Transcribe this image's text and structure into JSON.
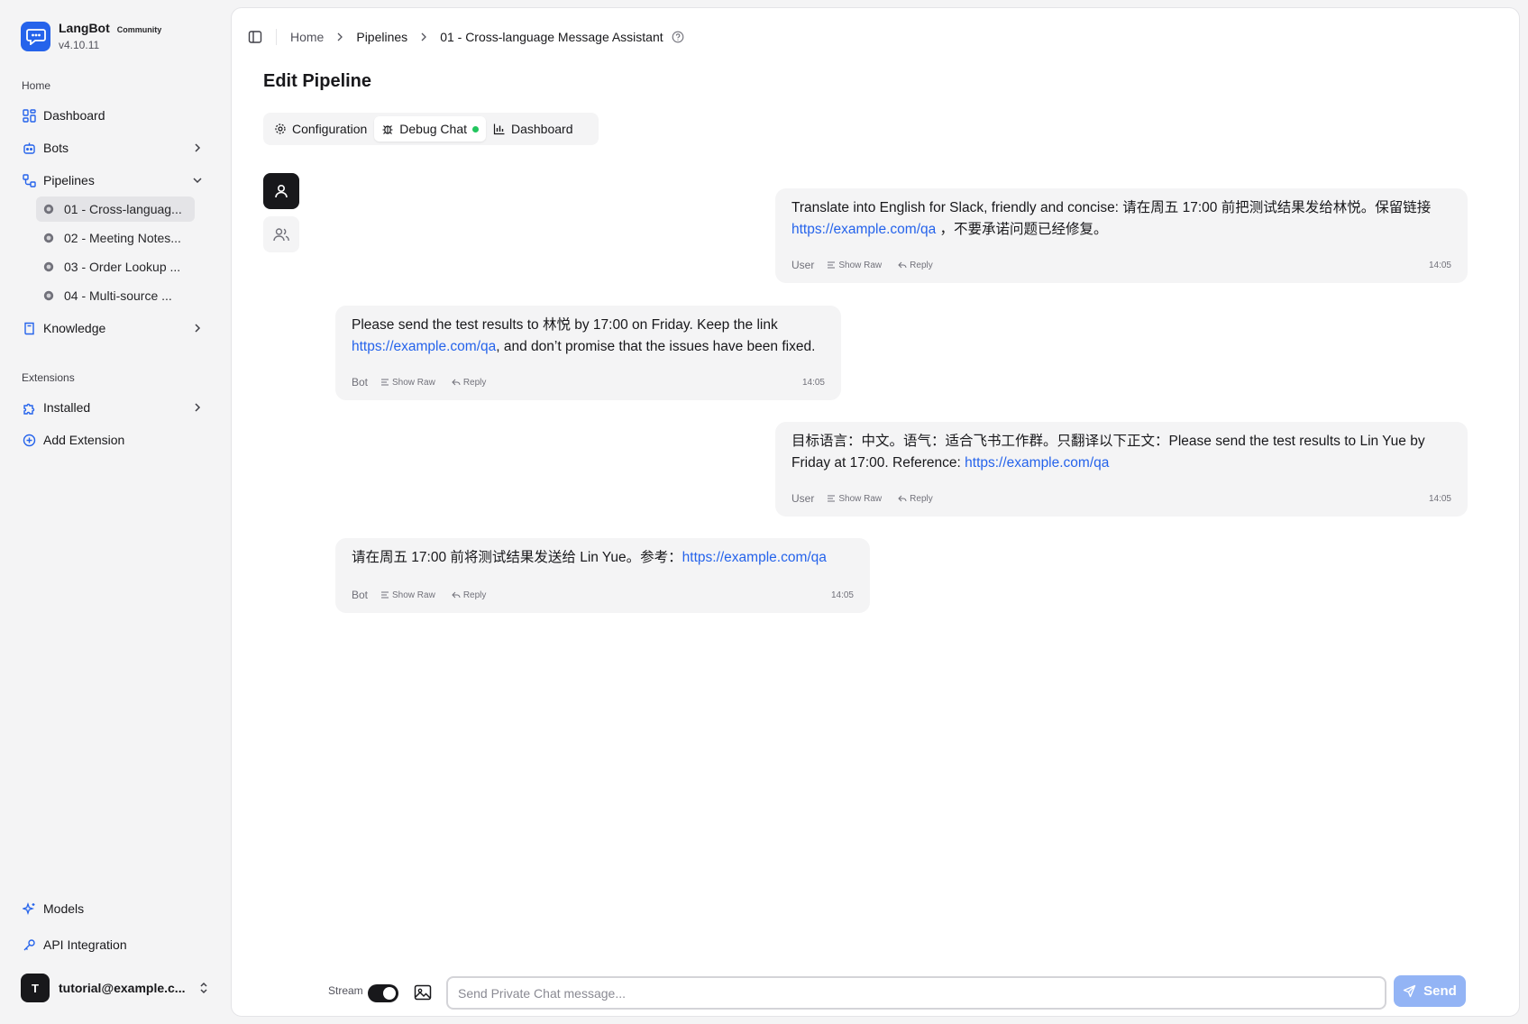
{
  "app": {
    "name": "LangBot",
    "badge": "Community",
    "version": "v4.10.11"
  },
  "sidebar": {
    "home_label": "Home",
    "extensions_label": "Extensions",
    "nav": {
      "dashboard": "Dashboard",
      "bots": "Bots",
      "pipelines": "Pipelines",
      "knowledge": "Knowledge",
      "installed": "Installed",
      "add_extension": "Add Extension",
      "models": "Models",
      "api_integration": "API Integration"
    },
    "pipelines": [
      {
        "label": "01 - Cross-languag..."
      },
      {
        "label": "02 - Meeting Notes..."
      },
      {
        "label": "03 - Order Lookup ..."
      },
      {
        "label": "04 - Multi-source ..."
      }
    ],
    "user": {
      "initial": "T",
      "email": "tutorial@example.c..."
    }
  },
  "breadcrumb": {
    "home": "Home",
    "pipelines": "Pipelines",
    "current": "01 - Cross-language Message Assistant"
  },
  "page": {
    "title": "Edit Pipeline"
  },
  "tabs": {
    "configuration": "Configuration",
    "debug_chat": "Debug Chat",
    "dashboard": "Dashboard"
  },
  "messages": [
    {
      "role": "User",
      "text_before": "Translate into English for Slack, friendly and concise: 请在周五 17:00 前把测试结果发给林悦。保留链接 ",
      "link": "https://example.com/qa",
      "text_after": " ，不要承诺问题已经修复。",
      "show_raw": "Show Raw",
      "reply": "Reply",
      "time": "14:05"
    },
    {
      "role": "Bot",
      "text_before": "Please send the test results to 林悦 by 17:00 on Friday. Keep the link ",
      "link": "https://example.com/qa",
      "text_after": ", and don’t promise that the issues have been fixed.",
      "show_raw": "Show Raw",
      "reply": "Reply",
      "time": "14:05"
    },
    {
      "role": "User",
      "text_before": "目标语言：中文。语气：适合飞书工作群。只翻译以下正文：Please send the test results to Lin Yue by Friday at 17:00. Reference: ",
      "link": "https://example.com/qa",
      "text_after": "",
      "show_raw": "Show Raw",
      "reply": "Reply",
      "time": "14:05"
    },
    {
      "role": "Bot",
      "text_before": "请在周五 17:00 前将测试结果发送给 Lin Yue。参考：",
      "link": "https://example.com/qa",
      "text_after": "",
      "show_raw": "Show Raw",
      "reply": "Reply",
      "time": "14:05"
    }
  ],
  "composer": {
    "stream_label": "Stream",
    "stream_on": true,
    "placeholder": "Send Private Chat message...",
    "send_label": "Send"
  },
  "colors": {
    "accent": "#2563eb",
    "live": "#22c55e",
    "send_disabled": "#93b4f5"
  }
}
